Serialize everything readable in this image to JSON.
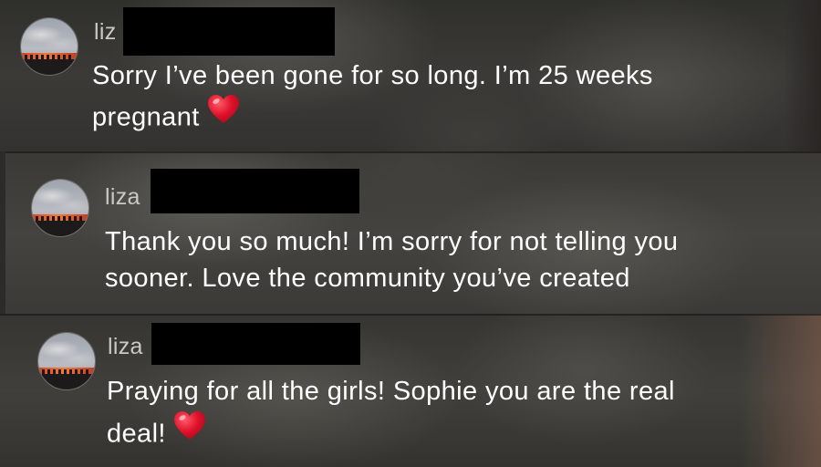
{
  "comments": [
    {
      "username": "liz",
      "lines": [
        "Sorry I’ve been gone for so long. I’m 25 weeks",
        "pregnant"
      ],
      "emoji": "red-heart-icon"
    },
    {
      "username": "liza",
      "lines": [
        "Thank you so much! I’m sorry for not telling you",
        "sooner. Love the community you’ve created"
      ]
    },
    {
      "username": "liza",
      "lines": [
        "Praying for all the girls! Sophie you are the real",
        "deal!"
      ],
      "emoji": "red-heart-icon"
    }
  ],
  "colors": {
    "text": "#ffffff",
    "username": "#c9c9c6",
    "heart": "#e0112b",
    "redaction": "#000000"
  }
}
